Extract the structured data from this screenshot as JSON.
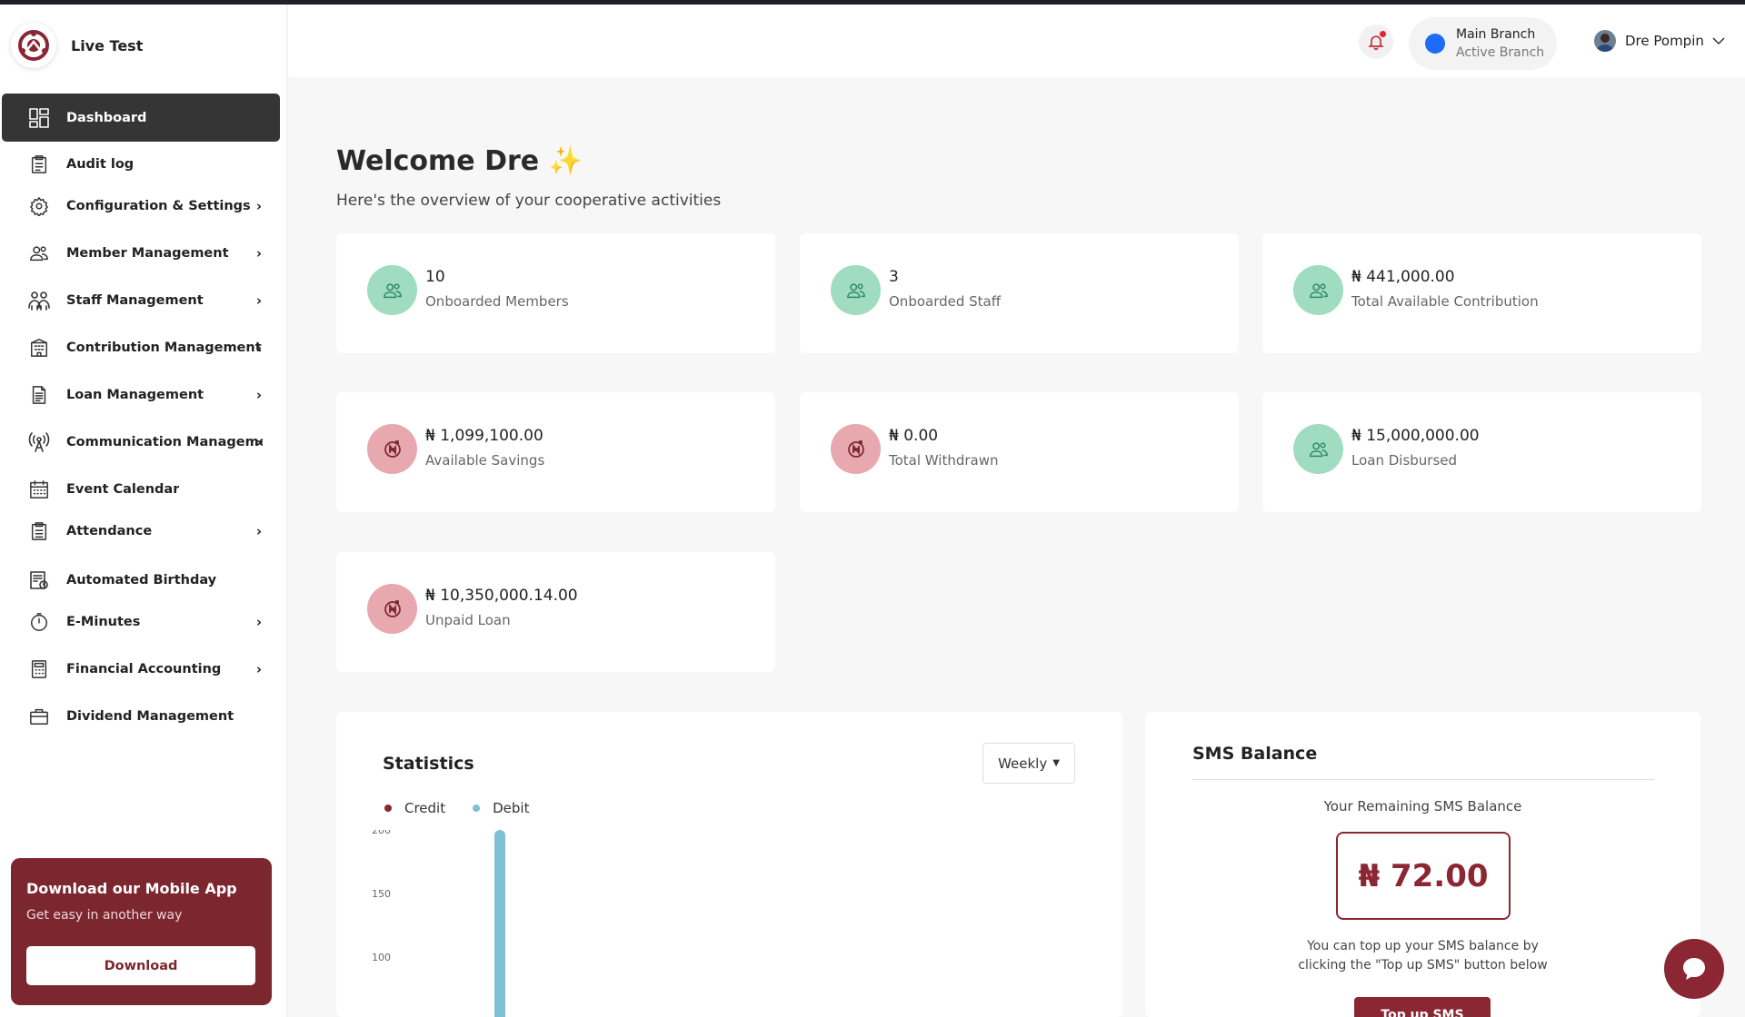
{
  "brand": {
    "name": "Live Test"
  },
  "sidebar": {
    "items": [
      {
        "label": "Dashboard",
        "icon": "dashboard-icon",
        "active": true,
        "has_children": false
      },
      {
        "label": "Audit log",
        "icon": "clipboard-icon",
        "has_children": false
      },
      {
        "label": "Configuration & Settings",
        "icon": "gear-icon",
        "has_children": true
      },
      {
        "label": "Member Management",
        "icon": "users-icon",
        "has_children": true
      },
      {
        "label": "Staff Management",
        "icon": "staff-icon",
        "has_children": true
      },
      {
        "label": "Contribution Management",
        "icon": "building-icon",
        "has_children": true
      },
      {
        "label": "Loan Management",
        "icon": "document-icon",
        "has_children": true
      },
      {
        "label": "Communication Managemen",
        "icon": "broadcast-icon",
        "has_children": true
      },
      {
        "label": "Event Calendar",
        "icon": "calendar-icon",
        "has_children": false
      },
      {
        "label": "Attendance",
        "icon": "clipboard-check-icon",
        "has_children": true
      },
      {
        "label": "Automated Birthday",
        "icon": "birthday-icon",
        "has_children": false
      },
      {
        "label": "E-Minutes",
        "icon": "stopwatch-icon",
        "has_children": true
      },
      {
        "label": "Financial Accounting",
        "icon": "calculator-icon",
        "has_children": true
      },
      {
        "label": "Dividend Management",
        "icon": "briefcase-icon",
        "has_children": false
      }
    ],
    "chevron": "›"
  },
  "promo": {
    "title": "Download our Mobile App",
    "subtitle": "Get easy in another way",
    "button": "Download"
  },
  "header": {
    "branch_name": "Main Branch",
    "branch_status": "Active Branch",
    "user_name": "Dre Pompin",
    "accent": "#1e6bf5"
  },
  "welcome": {
    "title": "Welcome Dre ✨",
    "subtitle": "Here's the overview of your cooperative activities"
  },
  "cards": [
    {
      "value": "10",
      "label": "Onboarded Members",
      "tone": "green",
      "icon": "users-icon"
    },
    {
      "value": "3",
      "label": "Onboarded Staff",
      "tone": "green",
      "icon": "users-icon"
    },
    {
      "value": "₦ 441,000.00",
      "label": "Total Available Contribution",
      "tone": "green",
      "icon": "users-icon"
    },
    {
      "value": "₦ 1,099,100.00",
      "label": "Available Savings",
      "tone": "red",
      "icon": "naira-coin-icon"
    },
    {
      "value": "₦ 0.00",
      "label": "Total Withdrawn",
      "tone": "red",
      "icon": "naira-coin-icon"
    },
    {
      "value": "₦ 15,000,000.00",
      "label": "Loan Disbursed",
      "tone": "green",
      "icon": "users-icon"
    },
    {
      "value": "₦ 10,350,000.14.00",
      "label": "Unpaid Loan",
      "tone": "red",
      "icon": "naira-coin-icon"
    }
  ],
  "statistics": {
    "title": "Statistics",
    "period": "Weekly"
  },
  "chart_data": {
    "type": "bar",
    "series": [
      {
        "name": "Credit",
        "color": "#8b2633",
        "values": []
      },
      {
        "name": "Debit",
        "color": "#7ec0d4",
        "values": [
          200
        ]
      }
    ],
    "yticks": [
      "200",
      "150",
      "100"
    ],
    "ylim": [
      0,
      200
    ]
  },
  "sms": {
    "title": "SMS Balance",
    "subtitle": "Your Remaining SMS Balance",
    "balance": "₦ 72.00",
    "note_line1": "You can top up your SMS balance by",
    "note_line2": "clicking the \"Top up SMS\" button below",
    "button": "Top up SMS"
  },
  "colors": {
    "brand": "#7c2630",
    "sidebar_active": "#353535",
    "green_circle": "#9fdcc0",
    "red_circle": "#e8a8af"
  }
}
